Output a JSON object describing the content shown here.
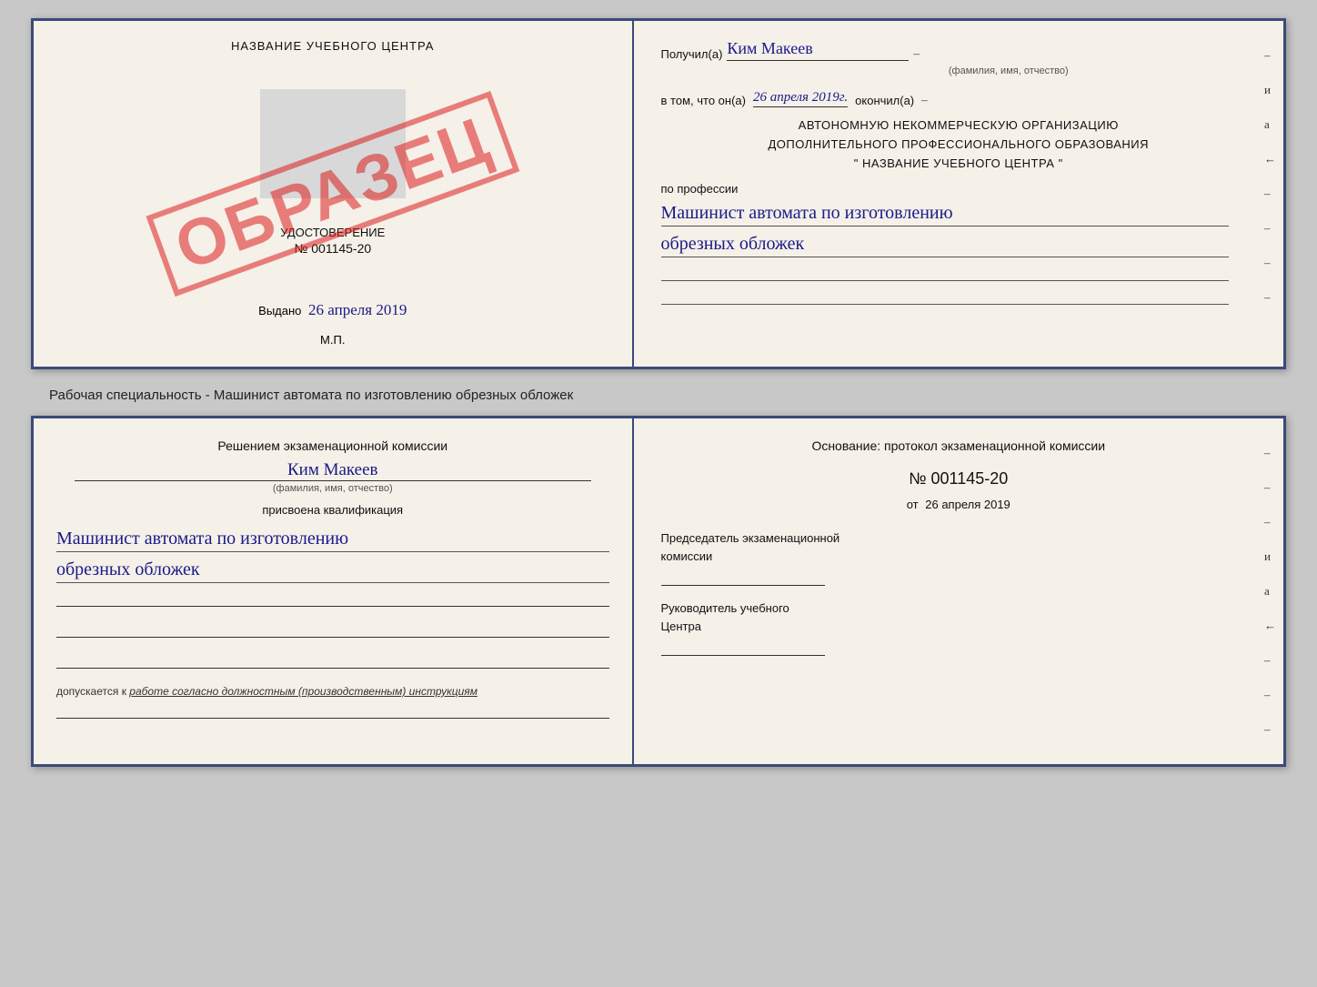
{
  "top_doc": {
    "left": {
      "school_name": "НАЗВАНИЕ УЧЕБНОГО ЦЕНТРА",
      "udostoverenie": "УДОСТОВЕРЕНИЕ",
      "number": "№ 001145-20",
      "issued_label": "Выдано",
      "issued_date": "26 апреля 2019",
      "mp_label": "М.П.",
      "stamp": "ОБРАЗЕЦ"
    },
    "right": {
      "recipient_label": "Получил(а)",
      "recipient_name": "Ким Макеев",
      "name_sublabel": "(фамилия, имя, отчество)",
      "dash1": "–",
      "completed_prefix": "в том, что он(а)",
      "completed_date": "26 апреля 2019г.",
      "completed_suffix": "окончил(а)",
      "dash2": "–",
      "org_line1": "АВТОНОМНУЮ НЕКОММЕРЧЕСКУЮ ОРГАНИЗАЦИЮ",
      "org_line2": "ДОПОЛНИТЕЛЬНОГО ПРОФЕССИОНАЛЬНОГО ОБРАЗОВАНИЯ",
      "org_name": "\"  НАЗВАНИЕ УЧЕБНОГО ЦЕНТРА  \"",
      "dash3": "–",
      "side_i": "и",
      "side_a": "а",
      "side_arrow": "←",
      "profession_label": "по профессии",
      "profession_line1": "Машинист автомата по изготовлению",
      "profession_line2": "обрезных обложек",
      "dashes": [
        "–",
        "–",
        "–",
        "–",
        "–"
      ]
    }
  },
  "specialty_text": "Рабочая специальность - Машинист автомата по изготовлению обрезных обложек",
  "bottom_doc": {
    "left": {
      "commission_text": "Решением экзаменационной комиссии",
      "name": "Ким Макеев",
      "name_sublabel": "(фамилия, имя, отчество)",
      "qualification_label": "присвоена квалификация",
      "qualification_line1": "Машинист автомата по изготовлению",
      "qualification_line2": "обрезных обложек",
      "blank_lines_count": 3,
      "allowed_prefix": "допускается к",
      "allowed_text": "работе согласно должностным (производственным) инструкциям"
    },
    "right": {
      "osnov_label": "Основание: протокол экзаменационной комиссии",
      "protocol_number": "№  001145-20",
      "date_prefix": "от",
      "date": "26 апреля 2019",
      "dash_after_date": "–",
      "chairman_label1": "Председатель экзаменационной",
      "chairman_label2": "комиссии",
      "side_dashes": [
        "–",
        "–",
        "–",
        "и",
        "а",
        "←",
        "–",
        "–",
        "–"
      ],
      "director_label1": "Руководитель учебного",
      "director_label2": "Центра"
    }
  }
}
